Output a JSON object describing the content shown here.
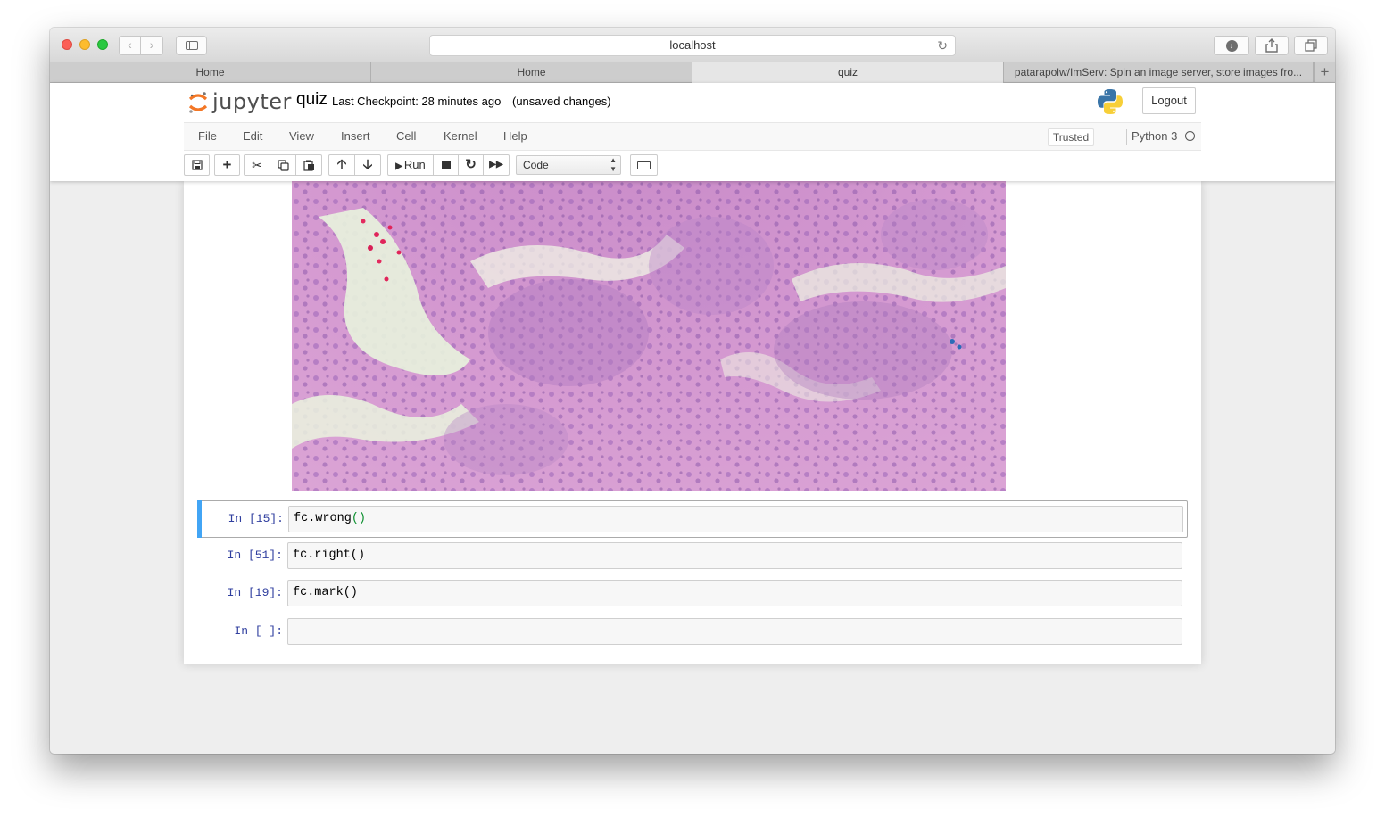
{
  "browser": {
    "address": "localhost",
    "tabs": [
      {
        "label": "Home"
      },
      {
        "label": "Home"
      },
      {
        "label": "quiz"
      },
      {
        "label": "patarapolw/ImServ: Spin an image server, store images fro..."
      }
    ],
    "new_tab_label": "+"
  },
  "jupyter": {
    "logo_text": "jupyter",
    "notebook_name": "quiz",
    "checkpoint": "Last Checkpoint: 28 minutes ago",
    "unsaved": "(unsaved changes)",
    "logout_label": "Logout"
  },
  "menu": {
    "items": [
      "File",
      "Edit",
      "View",
      "Insert",
      "Cell",
      "Kernel",
      "Help"
    ],
    "trusted": "Trusted",
    "kernel": "Python 3"
  },
  "toolbar": {
    "run_label": "Run",
    "cell_type": "Code"
  },
  "cells": [
    {
      "prompt": "In [15]:",
      "code": "fc.wrong",
      "code_suffix": "()",
      "selected": true
    },
    {
      "prompt": "In [51]:",
      "code": "fc.right()",
      "selected": false
    },
    {
      "prompt": "In [19]:",
      "code": "fc.mark()",
      "selected": false
    },
    {
      "prompt": "In [ ]:",
      "code": "",
      "selected": false
    }
  ],
  "colors": {
    "selected_cell_bar": "#42a5f5",
    "prompt": "#303f9f",
    "paren_match": "#0b8f2e"
  },
  "output": {
    "image": "histology micrograph (pink/purple H&E stained tissue)"
  }
}
